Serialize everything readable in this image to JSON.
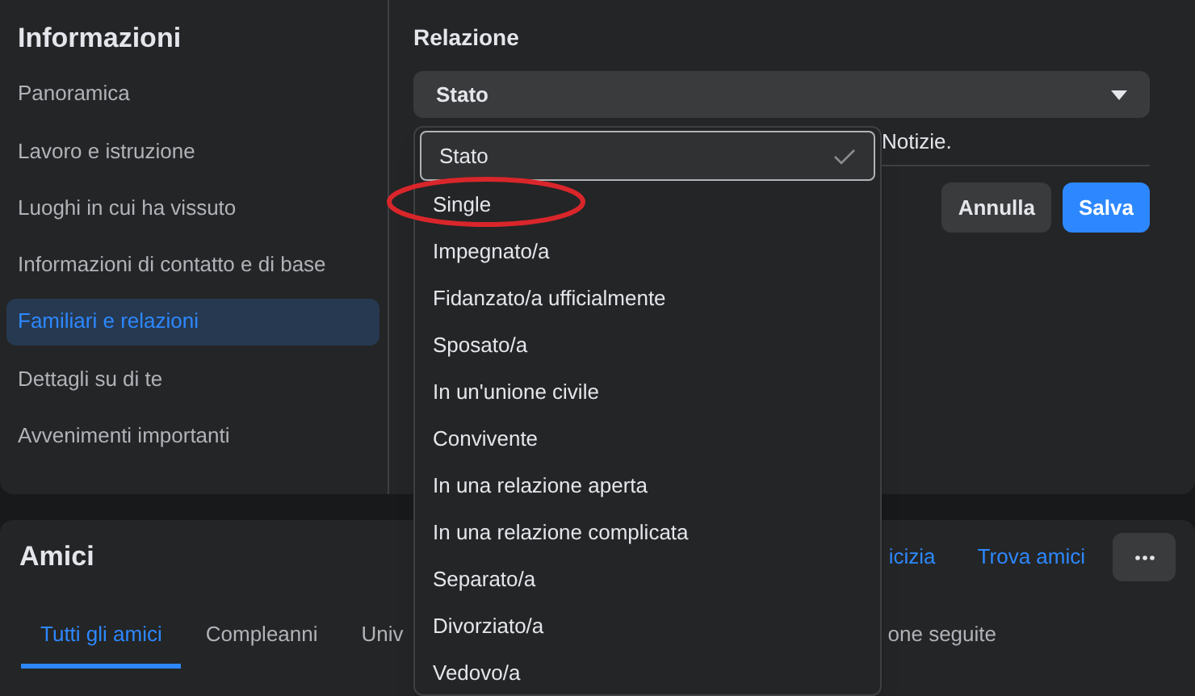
{
  "sidebar": {
    "title": "Informazioni",
    "items": [
      {
        "label": "Panoramica",
        "selected": false
      },
      {
        "label": "Lavoro e istruzione",
        "selected": false
      },
      {
        "label": "Luoghi in cui ha vissuto",
        "selected": false
      },
      {
        "label": "Informazioni di contatto e di base",
        "selected": false
      },
      {
        "label": "Familiari e relazioni",
        "selected": true
      },
      {
        "label": "Dettagli su di te",
        "selected": false
      },
      {
        "label": "Avvenimenti importanti",
        "selected": false
      }
    ]
  },
  "relationship": {
    "title": "Relazione",
    "select_value": "Stato",
    "note": "Notizie.",
    "buttons": [
      {
        "label": "Annulla",
        "kind": "secondary"
      },
      {
        "label": "Salva",
        "kind": "primary"
      }
    ]
  },
  "dropdown": {
    "options": [
      {
        "label": "Stato",
        "selected": true
      },
      {
        "label": "Single",
        "selected": false
      },
      {
        "label": "Impegnato/a",
        "selected": false
      },
      {
        "label": "Fidanzato/a ufficialmente",
        "selected": false
      },
      {
        "label": "Sposato/a",
        "selected": false
      },
      {
        "label": "In un'unione civile",
        "selected": false
      },
      {
        "label": "Convivente",
        "selected": false
      },
      {
        "label": "In una relazione aperta",
        "selected": false
      },
      {
        "label": "In una relazione complicata",
        "selected": false
      },
      {
        "label": "Separato/a",
        "selected": false
      },
      {
        "label": "Divorziato/a",
        "selected": false
      },
      {
        "label": "Vedovo/a",
        "selected": false
      }
    ]
  },
  "friends": {
    "title": "Amici",
    "links": [
      "icizia",
      "Trova amici"
    ],
    "tabs": [
      {
        "label": "Tutti gli amici",
        "selected": true
      },
      {
        "label": "Compleanni",
        "selected": false
      },
      {
        "label": "Univ",
        "selected": false
      },
      {
        "label": "one seguite",
        "selected": false
      }
    ]
  }
}
